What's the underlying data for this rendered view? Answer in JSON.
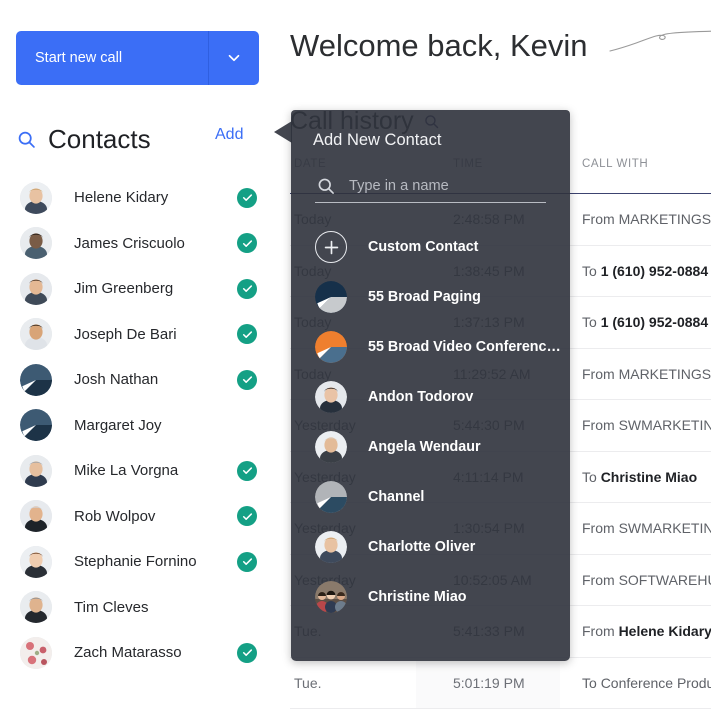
{
  "sidebar": {
    "start_call": {
      "label": "Start new call",
      "caret_icon": "chevron-down-icon"
    },
    "contacts": {
      "search_icon": "search-icon",
      "title": "Contacts",
      "add_label": "Add",
      "items": [
        {
          "name": "Helene Kidary",
          "avatar": "photo",
          "verified": true
        },
        {
          "name": "James Criscuolo",
          "avatar": "photo",
          "verified": true
        },
        {
          "name": "Jim Greenberg",
          "avatar": "photo",
          "verified": true
        },
        {
          "name": "Joseph De Bari",
          "avatar": "photo",
          "verified": true
        },
        {
          "name": "Josh Nathan",
          "avatar": "pie-navy",
          "verified": true
        },
        {
          "name": "Margaret Joy",
          "avatar": "pie-navy",
          "verified": false
        },
        {
          "name": "Mike La Vorgna",
          "avatar": "photo",
          "verified": true
        },
        {
          "name": "Rob Wolpov",
          "avatar": "photo",
          "verified": true
        },
        {
          "name": "Stephanie Fornino",
          "avatar": "photo",
          "verified": true
        },
        {
          "name": "Tim Cleves",
          "avatar": "photo",
          "verified": false
        },
        {
          "name": "Zach Matarasso",
          "avatar": "photo-floral",
          "verified": true
        }
      ]
    }
  },
  "main": {
    "welcome": "Welcome back, Kevin",
    "call_history": {
      "title": "Call history",
      "search_icon": "search-icon",
      "columns": [
        "DATE",
        "TIME",
        "CALL WITH"
      ],
      "rows": [
        {
          "date": "Today",
          "time": "2:48:58 PM",
          "direction": "From ",
          "party": "MARKETINGSW",
          "bold": false
        },
        {
          "date": "Today",
          "time": "1:38:45 PM",
          "direction": "To ",
          "party": "1 (610) 952-0884",
          "bold": true
        },
        {
          "date": "Today",
          "time": "1:37:13 PM",
          "direction": "To ",
          "party": "1 (610) 952-0884",
          "bold": true
        },
        {
          "date": "Today",
          "time": "11:29:52 AM",
          "direction": "From ",
          "party": "MARKETINGSW",
          "bold": false
        },
        {
          "date": "Yesterday",
          "time": "5:44:30 PM",
          "direction": "From ",
          "party": "SWMARKETING",
          "bold": false
        },
        {
          "date": "Yesterday",
          "time": "4:11:14 PM",
          "direction": "To ",
          "party": "Christine Miao",
          "bold": true
        },
        {
          "date": "Yesterday",
          "time": "1:30:54 PM",
          "direction": "From ",
          "party": "SWMARKETING",
          "bold": false
        },
        {
          "date": "Yesterday",
          "time": "10:52:05 AM",
          "direction": "From ",
          "party": "SOFTWAREHUBS",
          "bold": false
        },
        {
          "date": "Tue.",
          "time": "5:41:33 PM",
          "direction": "From ",
          "party": "Helene Kidary",
          "bold": true
        },
        {
          "date": "Tue.",
          "time": "5:01:19 PM",
          "direction": "To ",
          "party": "Conference Product_I",
          "bold": false
        }
      ]
    }
  },
  "modal": {
    "title": "Add New Contact",
    "search": {
      "icon": "search-icon",
      "value": "",
      "placeholder": "Type in a name"
    },
    "items": [
      {
        "label": "Custom Contact",
        "avatar": "plus-icon"
      },
      {
        "label": "55 Broad Paging",
        "avatar": "pie-navy-gray"
      },
      {
        "label": "55 Broad Video Conferenc…",
        "avatar": "pie-orange-blue"
      },
      {
        "label": "Andon Todorov",
        "avatar": "photo"
      },
      {
        "label": "Angela Wendaur",
        "avatar": "photo"
      },
      {
        "label": "Channel",
        "avatar": "pie-gray-navy"
      },
      {
        "label": "Charlotte Oliver",
        "avatar": "photo"
      },
      {
        "label": "Christine Miao",
        "avatar": "photo-group"
      }
    ]
  },
  "colors": {
    "accent_blue": "#3b6ef6",
    "verified_green": "#14a085",
    "modal_bg": "#2f323c",
    "header_rule": "#3c4370",
    "orange": "#ef7f2e",
    "steel_blue": "#4a6f8e",
    "navy": "#15314a"
  }
}
